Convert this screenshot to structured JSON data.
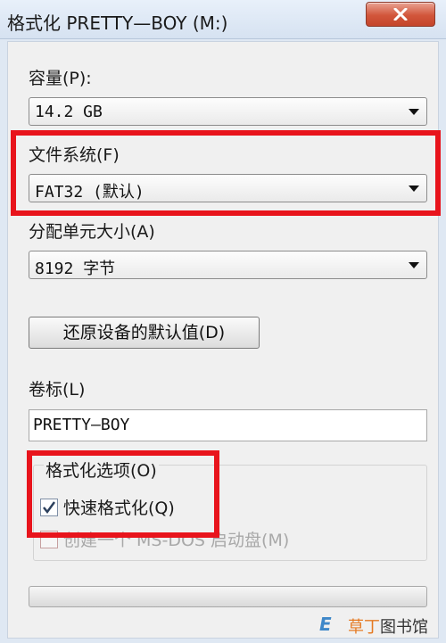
{
  "window": {
    "title": "格式化 PRETTY—BOY (M:)"
  },
  "capacity": {
    "label": "容量(P):",
    "value": "14.2 GB"
  },
  "filesystem": {
    "label": "文件系统(F)",
    "value": "FAT32 (默认)"
  },
  "allocation": {
    "label": "分配单元大小(A)",
    "value": "8192 字节"
  },
  "restore_button": {
    "label": "还原设备的默认值(D)"
  },
  "volume": {
    "label": "卷标(L)",
    "value": "PRETTY—BOY"
  },
  "format_options": {
    "label": "格式化选项(O)",
    "quick_format": {
      "label": "快速格式化(Q)",
      "checked": true
    },
    "msdos_disk": {
      "label": "创建一个 MS-DOS 启动盘(M)",
      "checked": false,
      "enabled": false
    }
  },
  "watermark": {
    "logo": "E",
    "text_a": "草丁",
    "text_b": "图书馆"
  },
  "colors": {
    "highlight": "#e8141c",
    "titlebar": "#dfe8f3",
    "close_button": "#d2563b"
  },
  "icons": {
    "close": "close-icon",
    "dropdown": "chevron-down-icon",
    "check": "checkmark-icon"
  }
}
